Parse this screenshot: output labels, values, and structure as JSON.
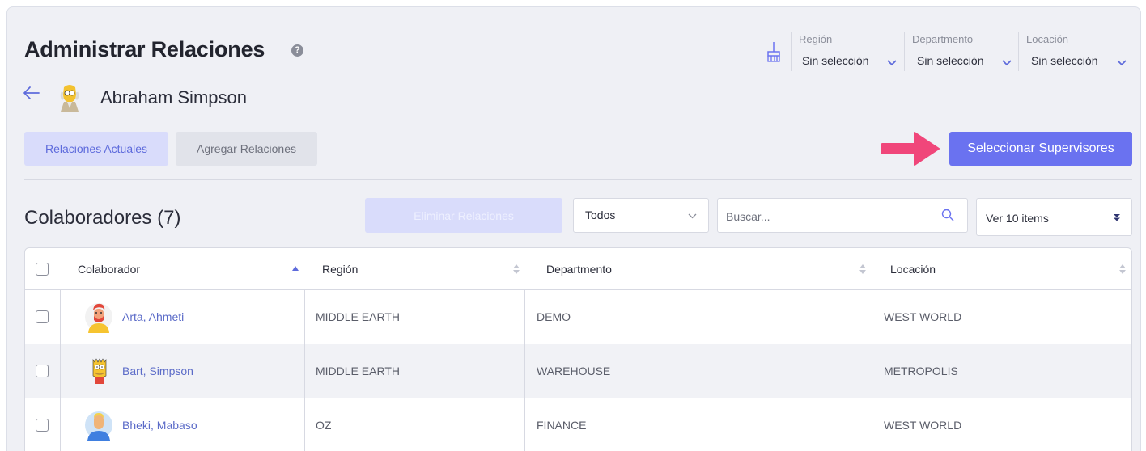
{
  "header": {
    "title": "Administrar Relaciones",
    "help_icon": "?",
    "person_name": "Abraham Simpson"
  },
  "filters": [
    {
      "label": "Región",
      "value": "Sin selección"
    },
    {
      "label": "Departmento",
      "value": "Sin selección"
    },
    {
      "label": "Locación",
      "value": "Sin selección"
    }
  ],
  "tabs": [
    {
      "label": "Relaciones Actuales",
      "active": true
    },
    {
      "label": "Agregar Relaciones",
      "active": false
    }
  ],
  "primary_button": "Seleccionar Supervisores",
  "section": {
    "title": "Colaboradores (7)",
    "delete_button": "Eliminar Relaciones",
    "filter_select": "Todos",
    "search_placeholder": "Buscar...",
    "page_size": "Ver 10 items"
  },
  "table": {
    "columns": [
      "Colaborador",
      "Región",
      "Departmento",
      "Locación"
    ],
    "rows": [
      {
        "name": "Arta, Ahmeti",
        "region": "MIDDLE EARTH",
        "department": "DEMO",
        "location": "WEST WORLD",
        "avatar": "red-hair-avatar"
      },
      {
        "name": "Bart, Simpson",
        "region": "MIDDLE EARTH",
        "department": "WAREHOUSE",
        "location": "METROPOLIS",
        "avatar": "bart-avatar"
      },
      {
        "name": "Bheki, Mabaso",
        "region": "OZ",
        "department": "FINANCE",
        "location": "WEST WORLD",
        "avatar": "blue-shirt-avatar"
      }
    ]
  },
  "colors": {
    "primary": "#6a72f0",
    "tab_active_bg": "#d9dcfb",
    "link": "#5b6bc8",
    "annotation_arrow": "#f0467a"
  }
}
